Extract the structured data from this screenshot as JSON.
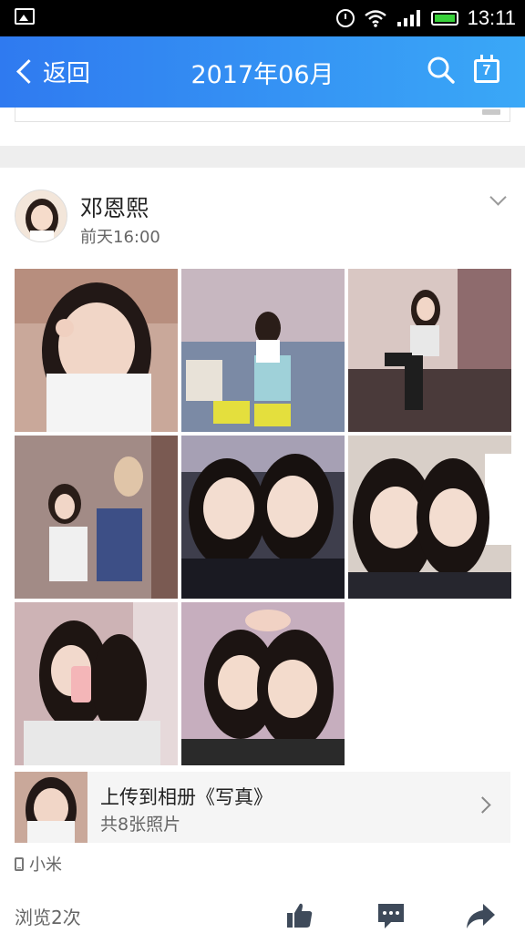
{
  "status_bar": {
    "time": "13:11",
    "icons": [
      "gallery-icon",
      "alarm-icon",
      "wifi-icon",
      "signal-icon",
      "battery-icon"
    ]
  },
  "app_bar": {
    "back_label": "返回",
    "title": "2017年06月",
    "search_icon": "search-icon",
    "calendar_day": "7",
    "color_start": "#2f7af0",
    "color_end": "#3aa8f7"
  },
  "post": {
    "author": "邓恩熙",
    "time": "前天16:00",
    "photos_count": 8,
    "album": {
      "title": "上传到相册《写真》",
      "count": "共8张照片"
    },
    "device": "小米",
    "views": "浏览2次",
    "actions": [
      "like-icon",
      "comment-icon",
      "share-icon"
    ]
  }
}
